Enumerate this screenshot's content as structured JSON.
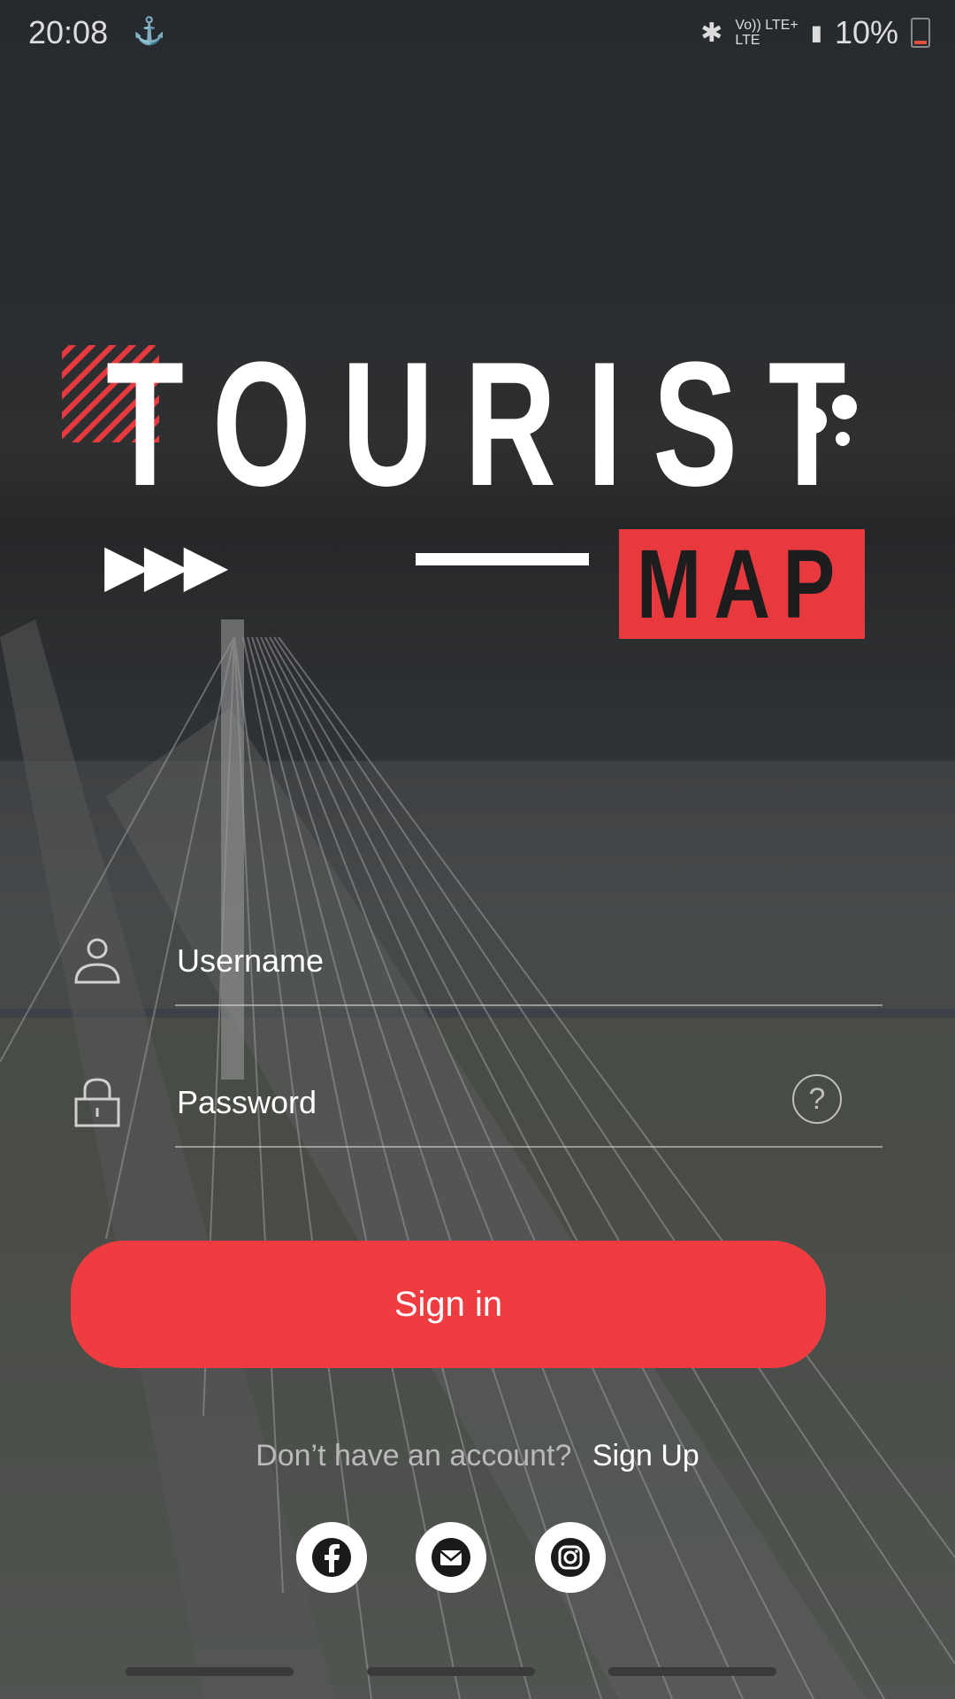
{
  "status_bar": {
    "time": "20:08",
    "network_top": "Vo)) LTE+",
    "network_bottom": "LTE",
    "battery": "10%"
  },
  "logo": {
    "word": "TOURIST",
    "sub": "MAP"
  },
  "form": {
    "username_placeholder": "Username",
    "password_placeholder": "Password",
    "help_symbol": "?"
  },
  "signin_label": "Sign in",
  "signup": {
    "question": "Don’t have an account?",
    "link": "Sign Up"
  },
  "social": [
    "facebook-icon",
    "mail-icon",
    "instagram-icon"
  ],
  "colors": {
    "accent": "#ee3c41",
    "text": "#ffffff"
  }
}
